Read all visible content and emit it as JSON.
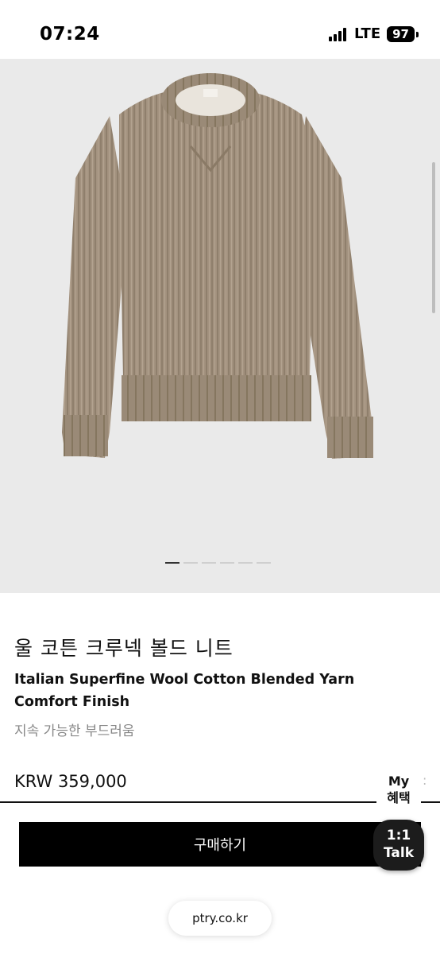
{
  "status_bar": {
    "time": "07:24",
    "network": "LTE",
    "battery": "97"
  },
  "product": {
    "title": "울 코튼 크루넥 볼드 니트",
    "subtitle": "Italian Superfine Wool Cotton Blended Yarn Comfort Finish",
    "tagline": "지속 가능한 부드러움",
    "price": "KRW 359,000",
    "image_icon": "sweater-image",
    "image_color": "#a3927f"
  },
  "carousel": {
    "total": 6,
    "active_index": 0
  },
  "floating": {
    "my_benefit": "My\n혜택",
    "my_benefit_line1": "My",
    "my_benefit_line2": "혜택",
    "talk_line1": "1:1",
    "talk_line2": "Talk"
  },
  "actions": {
    "buy_label": "구매하기"
  },
  "browser": {
    "url": "ptry.co.kr"
  }
}
